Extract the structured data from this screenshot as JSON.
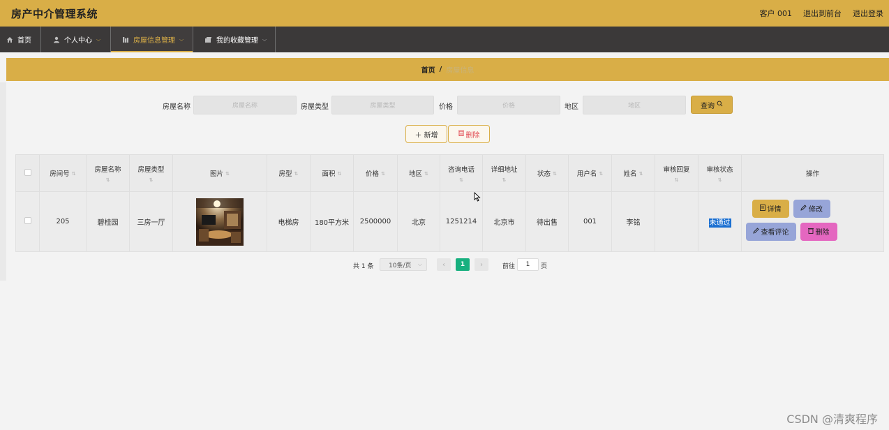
{
  "header": {
    "app_title": "房产中介管理系统",
    "links": [
      "客户 001",
      "退出到前台",
      "退出登录"
    ]
  },
  "nav": [
    {
      "label": "首页",
      "icon": "home-icon",
      "active": false,
      "has_arrow": false
    },
    {
      "label": "个人中心",
      "icon": "user-icon",
      "active": false,
      "has_arrow": true
    },
    {
      "label": "房屋信息管理",
      "icon": "building-icon",
      "active": true,
      "has_arrow": true
    },
    {
      "label": "我的收藏管理",
      "icon": "collection-icon",
      "active": false,
      "has_arrow": true
    }
  ],
  "breadcrumb": {
    "home": "首页",
    "separator": "/",
    "current": "房屋信息"
  },
  "search": {
    "fields": [
      {
        "label": "房屋名称",
        "placeholder": "房屋名称"
      },
      {
        "label": "房屋类型",
        "placeholder": "房屋类型"
      },
      {
        "label": "价格",
        "placeholder": "价格"
      },
      {
        "label": "地区",
        "placeholder": "地区"
      }
    ],
    "query_label": "查询"
  },
  "actions": {
    "add_label": "新增",
    "delete_label": "删除"
  },
  "table": {
    "columns": [
      "房间号",
      "房屋名称",
      "房屋类型",
      "图片",
      "房型",
      "面积",
      "价格",
      "地区",
      "咨询电话",
      "详细地址",
      "状态",
      "用户名",
      "姓名",
      "审核回复",
      "审核状态",
      "操作"
    ],
    "rows": [
      {
        "room_no": "205",
        "name": "碧桂园",
        "type": "三房一厅",
        "layout": "电梯房",
        "area": "180平方米",
        "price": "2500000",
        "region": "北京",
        "phone": "1251214",
        "address": "北京市",
        "status": "待出售",
        "username": "001",
        "realname": "李铭",
        "review_reply": "",
        "review_status": "未通过"
      }
    ],
    "row_actions": {
      "detail": "详情",
      "edit": "修改",
      "comments": "查看评论",
      "delete": "删除"
    }
  },
  "pagination": {
    "total_text": "共 1 条",
    "page_size": "10条/页",
    "current_page": "1",
    "goto_prefix": "前往",
    "goto_value": "1",
    "goto_suffix": "页"
  },
  "watermark": "CSDN @清爽程序",
  "colors": {
    "accent": "#d9ae47",
    "nav_bg": "#3b3939",
    "page_active": "#18b07f",
    "edit_btn": "#97a5d8",
    "delete_btn": "#e467c0"
  }
}
